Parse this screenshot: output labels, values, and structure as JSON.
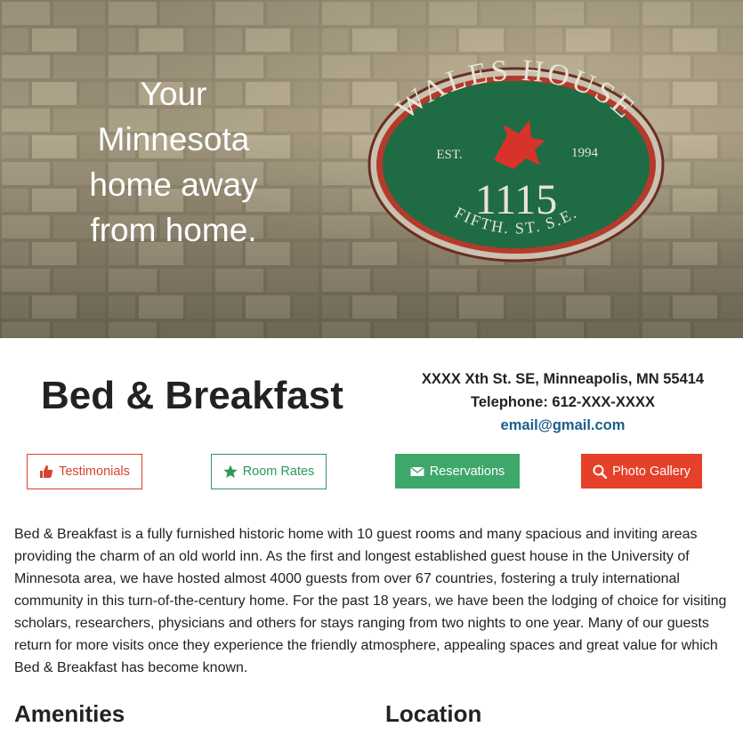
{
  "hero": {
    "tagline_lines": [
      "Your",
      "Minnesota",
      "home away",
      "from home."
    ],
    "sign": {
      "name": "WALES HOUSE",
      "est_label": "EST.",
      "year": "1994",
      "number": "1115",
      "street": "FIFTH. ST. S.E."
    }
  },
  "brand": {
    "title": "Bed & Breakfast"
  },
  "contact": {
    "address": "XXXX Xth St. SE, Minneapolis, MN 55414",
    "phone": "Telephone: 612-XXX-XXXX",
    "email": "email@gmail.com"
  },
  "buttons": {
    "testimonials": {
      "label": "Testimonials",
      "icon": "thumbs-up-icon"
    },
    "room_rates": {
      "label": "Room Rates",
      "icon": "star-icon"
    },
    "reservations": {
      "label": "Reservations",
      "icon": "envelope-icon"
    },
    "photo_gallery": {
      "label": "Photo Gallery",
      "icon": "search-icon"
    }
  },
  "intro": "Bed & Breakfast is a fully furnished historic home with 10 guest rooms and many spacious and inviting areas providing the charm of an old world inn. As the first and longest established guest house in the University of Minnesota area, we have hosted almost 4000 guests from over 67 countries, fostering a truly international community in this turn-of-the-century home. For the past 18 years, we have been the lodging of choice for visiting scholars, researchers, physicians and others for stays ranging from two nights to one year. Many of our guests return for more visits once they experience the friendly atmosphere, appealing spaces and great value for which Bed & Breakfast has become known.",
  "sections": {
    "amenities": "Amenities",
    "location": "Location"
  },
  "colors": {
    "red": "#e5402a",
    "green": "#3ea76a",
    "link_blue": "#1d5f8a"
  }
}
